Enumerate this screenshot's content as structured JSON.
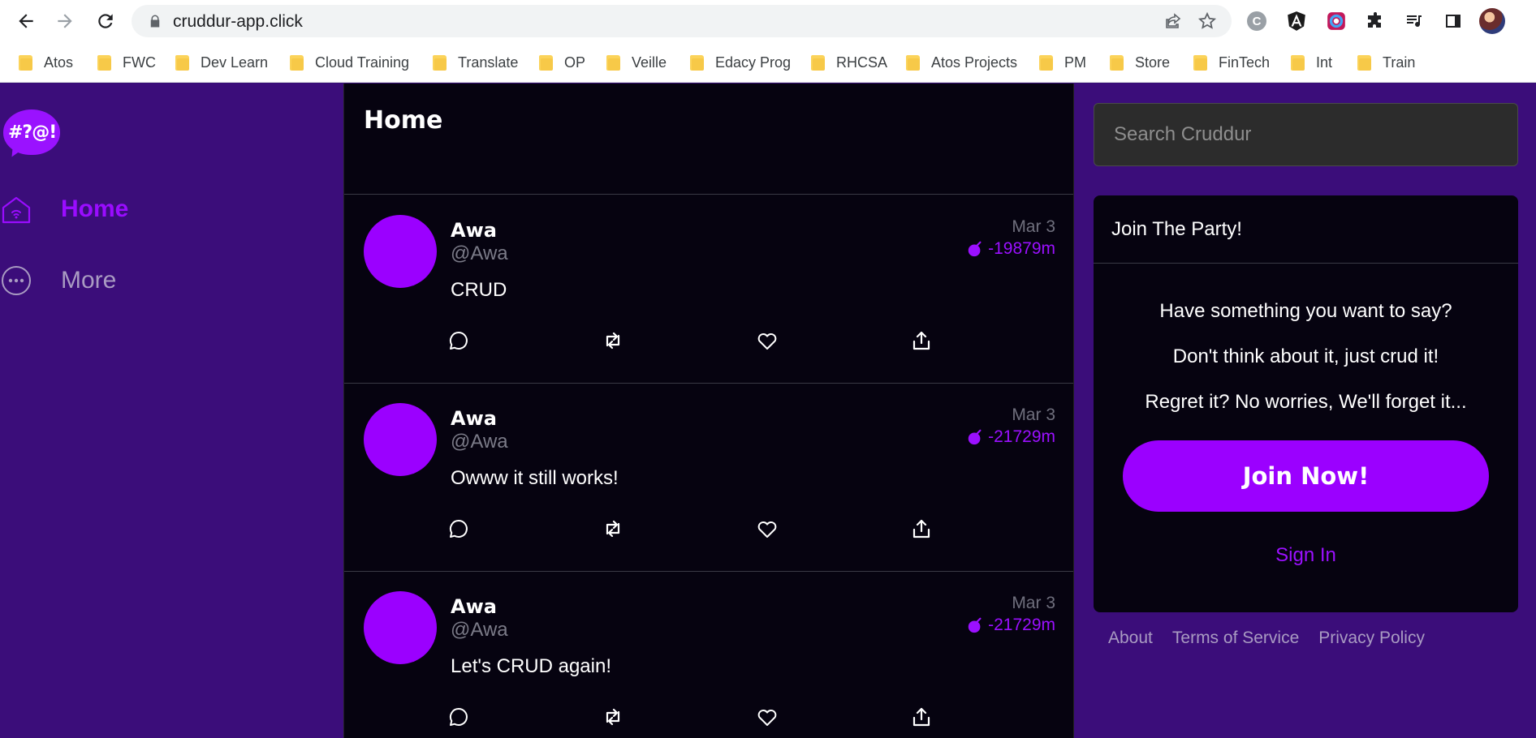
{
  "browser": {
    "url": "cruddur-app.click",
    "bookmarks": [
      "Atos",
      "FWC",
      "Dev Learn",
      "Cloud Training",
      "Translate",
      "OP",
      "Veille",
      "Edacy Prog",
      "RHCSA",
      "Atos Projects",
      "PM",
      "Store",
      "FinTech",
      "Int",
      "Train"
    ],
    "extension_c_label": "C"
  },
  "logo": {
    "text": "#?@!"
  },
  "sidebar": {
    "items": [
      {
        "label": "Home",
        "icon": "home-icon"
      },
      {
        "label": "More",
        "icon": "more-icon"
      }
    ]
  },
  "feed": {
    "title": "Home",
    "posts": [
      {
        "name": "Awa",
        "handle": "@Awa",
        "body": "CRUD",
        "date": "Mar 3",
        "score": "-19879m"
      },
      {
        "name": "Awa",
        "handle": "@Awa",
        "body": "Owww it still works!",
        "date": "Mar 3",
        "score": "-21729m"
      },
      {
        "name": "Awa",
        "handle": "@Awa",
        "body": "Let's CRUD again!",
        "date": "Mar 3",
        "score": "-21729m"
      }
    ]
  },
  "search": {
    "placeholder": "Search Cruddur"
  },
  "join": {
    "title": "Join The Party!",
    "lines": [
      "Have something you want to say?",
      "Don't think about it, just crud it!",
      "Regret it? No worries, We'll forget it..."
    ],
    "button": "Join Now!",
    "sign_in": "Sign In"
  },
  "footer": {
    "links": [
      "About",
      "Terms of Service",
      "Privacy Policy"
    ]
  },
  "colors": {
    "accent": "#9b00ff",
    "sidebar_bg": "#3b0d7a",
    "feed_bg": "#060310"
  }
}
